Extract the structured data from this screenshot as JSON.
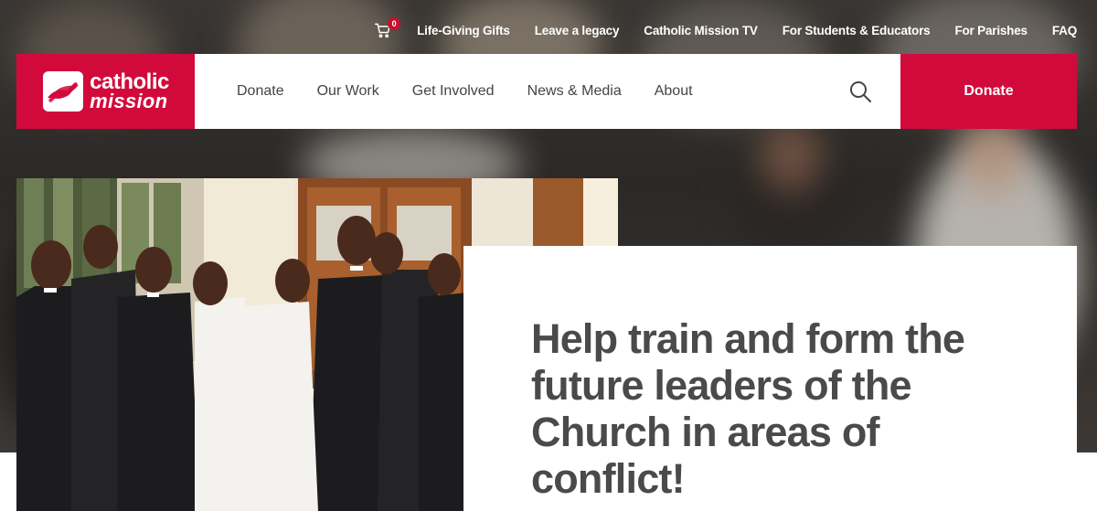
{
  "utility_nav": {
    "cart_count": "0",
    "links": [
      "Life-Giving Gifts",
      "Leave a legacy",
      "Catholic Mission TV",
      "For Students & Educators",
      "For Parishes",
      "FAQ"
    ]
  },
  "header": {
    "logo": {
      "line1": "catholic",
      "line2": "mission"
    },
    "nav": [
      "Donate",
      "Our Work",
      "Get Involved",
      "News & Media",
      "About"
    ],
    "donate_label": "Donate"
  },
  "hero": {
    "headline": "Help train and form the future leaders of the Church in areas of conflict!"
  },
  "colors": {
    "brand_red": "#d20a3c",
    "headline_gray": "#4a4a4a",
    "nav_text": "#444444"
  },
  "icons": [
    "cart-icon",
    "search-icon",
    "logo-hands-icon"
  ]
}
